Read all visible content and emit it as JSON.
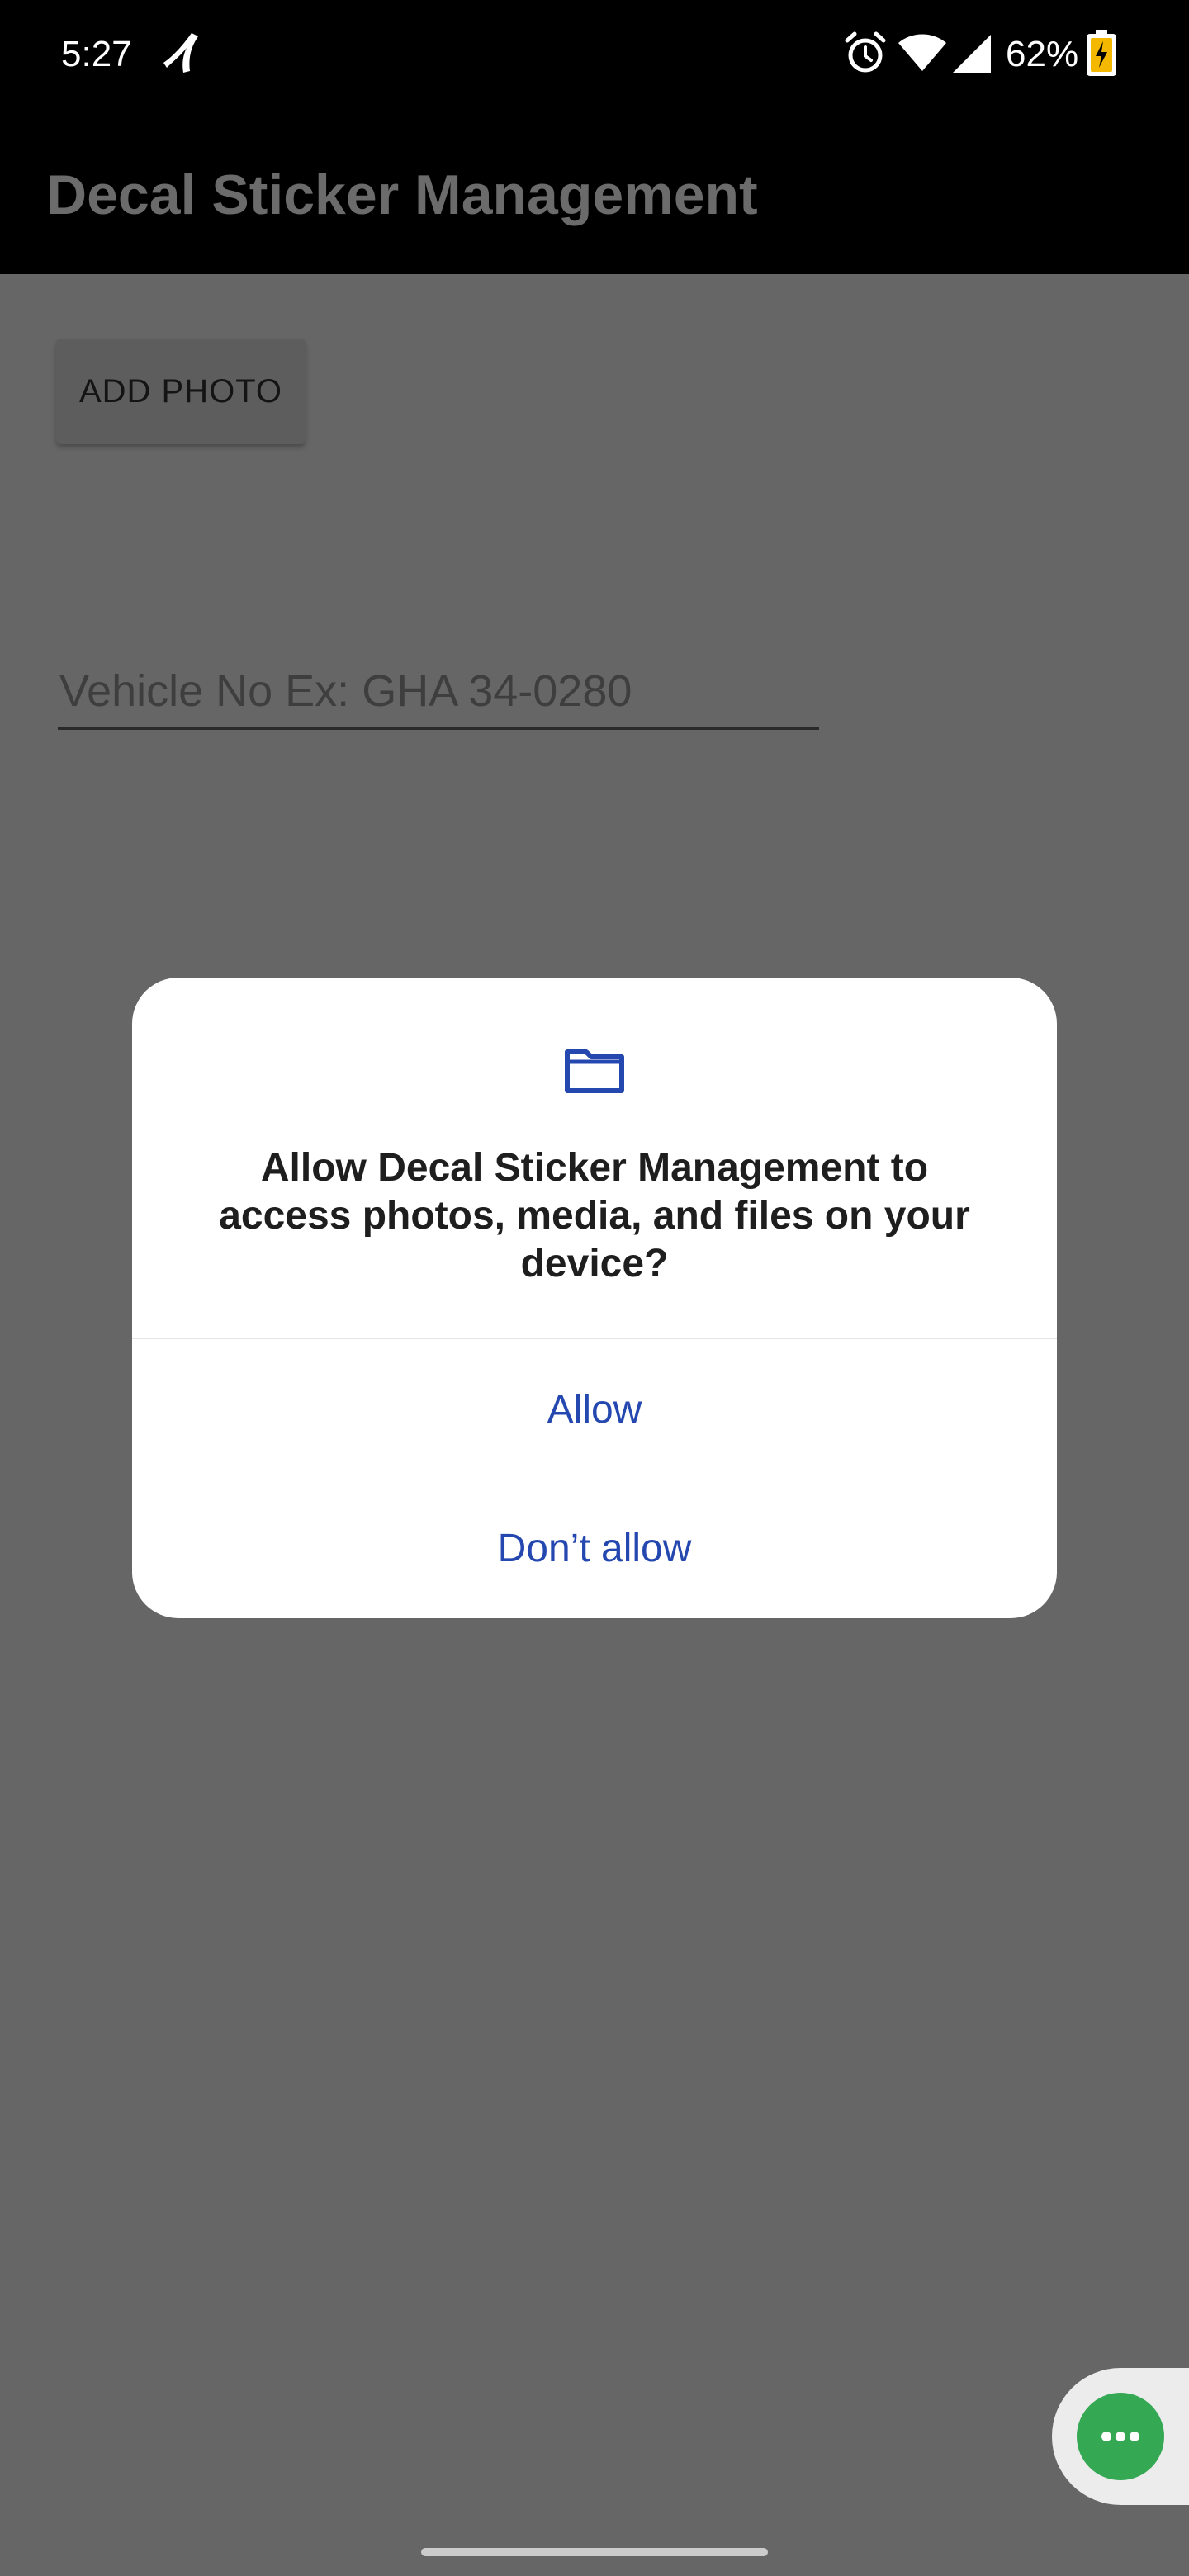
{
  "status_bar": {
    "time": "5:27",
    "battery_percent": "62%",
    "icons": [
      "carrier-icon",
      "alarm-icon",
      "wifi-icon",
      "signal-icon",
      "battery-charging-icon"
    ]
  },
  "app_bar": {
    "title": "Decal Sticker Management"
  },
  "main": {
    "add_photo_label": "ADD PHOTO",
    "vehicle_placeholder": "Vehicle No Ex: GHA 34-0280",
    "vehicle_value": ""
  },
  "dialog": {
    "icon": "folder-icon",
    "message": "Allow Decal Sticker Management to access photos, media, and files on your device?",
    "allow_label": "Allow",
    "deny_label": "Don’t allow"
  },
  "bubble": {
    "icon": "more-horizontal-icon"
  },
  "colors": {
    "dialog_button_text": "#2448b0",
    "bubble_green": "#34a853",
    "scrim": "#666666",
    "app_bar": "#000000"
  }
}
